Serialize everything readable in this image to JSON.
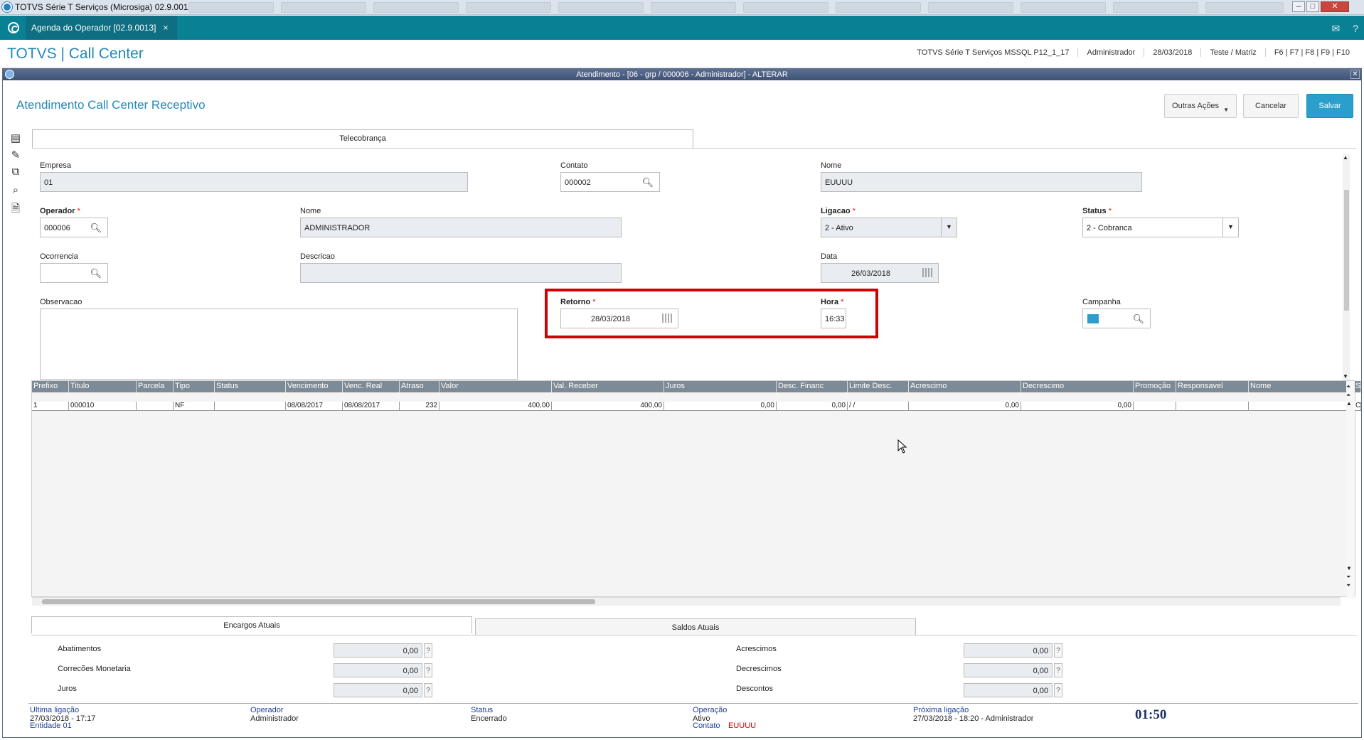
{
  "window": {
    "title": "TOTVS Série T Serviços (Microsiga) 02.9.0013"
  },
  "tabbar": {
    "tab_label": "Agenda do Operador [02.9.0013]",
    "tab_close": "×"
  },
  "header": {
    "brand": "TOTVS | Call Center",
    "environment": "TOTVS Série T Serviços MSSQL P12_1_17",
    "user": "Administrador",
    "date": "28/03/2018",
    "company": "Teste / Matriz",
    "shortcuts": "F6 | F7 | F8 | F9 | F10"
  },
  "dialog": {
    "title": "Atendimento - [06 - grp / 000006 - Administrador] - ALTERAR",
    "page_title": "Atendimento Call Center Receptivo",
    "buttons": {
      "outras": "Outras Ações",
      "cancelar": "Cancelar",
      "salvar": "Salvar"
    }
  },
  "form": {
    "tab": "Telecobrança",
    "empresa": {
      "label": "Empresa",
      "value": "01"
    },
    "contato": {
      "label": "Contato",
      "value": "000002"
    },
    "nome1": {
      "label": "Nome",
      "value": "EUUUU"
    },
    "operador": {
      "label": "Operador",
      "value": "000006"
    },
    "nome2": {
      "label": "Nome",
      "value": "ADMINISTRADOR"
    },
    "ligacao": {
      "label": "Ligacao",
      "value": "2 - Ativo"
    },
    "status": {
      "label": "Status",
      "value": "2 - Cobranca"
    },
    "ocorrencia": {
      "label": "Ocorrencia",
      "value": ""
    },
    "descricao": {
      "label": "Descricao",
      "value": ""
    },
    "data": {
      "label": "Data",
      "value": "26/03/2018"
    },
    "observacao": {
      "label": "Observacao",
      "value": ""
    },
    "retorno": {
      "label": "Retorno",
      "value": "28/03/2018"
    },
    "hora": {
      "label": "Hora",
      "value": "16:33"
    },
    "campanha": {
      "label": "Campanha"
    },
    "required_mark": "*"
  },
  "grid": {
    "columns": [
      "Prefixo",
      "Titulo",
      "Parcela",
      "Tipo",
      "Status",
      "Vencimento",
      "Venc. Real",
      "Atraso",
      "Valor",
      "Val. Receber",
      "Juros",
      "Desc. Financ",
      "Limite Desc.",
      "Acrescimo",
      "Decrescimo",
      "Promoção",
      "Responsavel",
      "Nome",
      "S"
    ],
    "rows": [
      [
        "1",
        "000010",
        "",
        "NF",
        "",
        "08/08/2017",
        "08/08/2017",
        "232",
        "400,00",
        "400,00",
        "0,00",
        "0,00",
        " /  /",
        "0,00",
        "0,00",
        "",
        "",
        "",
        "C"
      ]
    ]
  },
  "bottom_tabs": {
    "encargos": "Encargos Atuais",
    "saldos": "Saldos Atuais"
  },
  "summary": {
    "abatimentos": {
      "label": "Abatimentos",
      "value": "0,00"
    },
    "correcoes": {
      "label": "Correcões Monetaria",
      "value": "0,00"
    },
    "juros": {
      "label": "Juros",
      "value": "0,00"
    },
    "acrescimos": {
      "label": "Acrescimos",
      "value": "0,00"
    },
    "decrescimos": {
      "label": "Decrescimos",
      "value": "0,00"
    },
    "descontos": {
      "label": "Descontos",
      "value": "0,00"
    },
    "help": "?"
  },
  "footer": {
    "ultima_label": "Ultima ligação",
    "ultima_value": "27/03/2018 - 17:17",
    "entidade": "Entidade 01",
    "operador_label": "Operador",
    "operador_value": "Administrador",
    "status_label": "Status",
    "status_value": "Encerrado",
    "operacao_label": "Operação",
    "operacao_value": "Ativo",
    "contato_label": "Contato",
    "contato_value": "EUUUU",
    "proxima_label": "Próxima ligação",
    "proxima_value": "27/03/2018 - 18:20 - Administrador",
    "timer": "01:50"
  },
  "colors": {
    "accent": "#2389b9",
    "tabbar": "#0a8095",
    "highlight": "#d00000"
  }
}
